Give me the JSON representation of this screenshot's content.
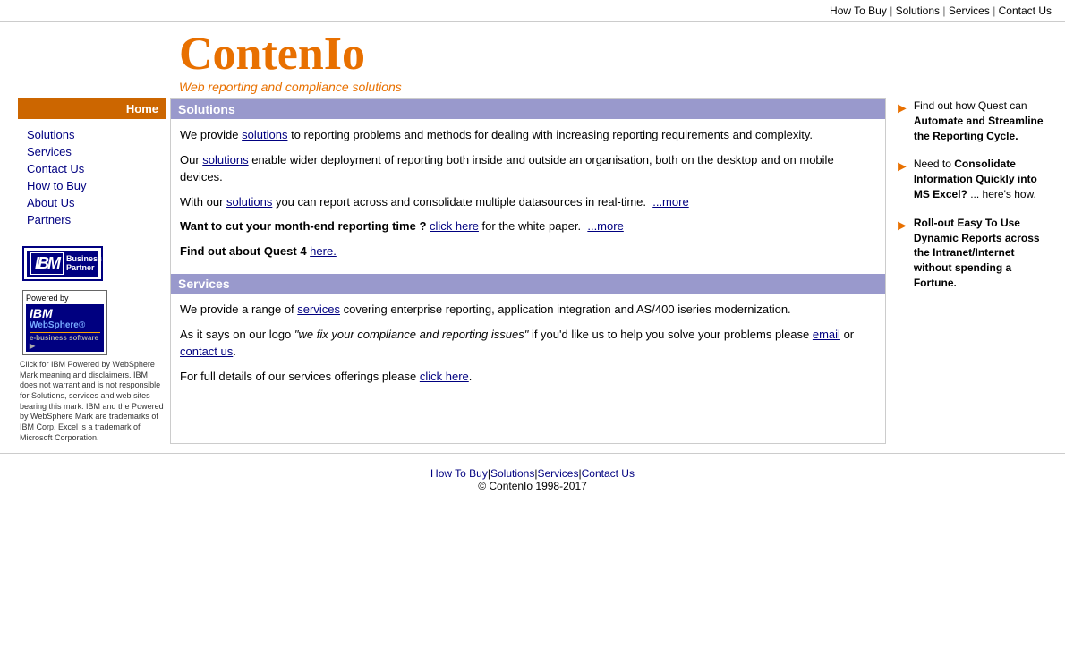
{
  "topnav": {
    "items": [
      {
        "label": "How To Buy",
        "href": "#"
      },
      {
        "label": "Solutions",
        "href": "#"
      },
      {
        "label": "Services",
        "href": "#"
      },
      {
        "label": "Contact Us",
        "href": "#"
      }
    ]
  },
  "header": {
    "logo": "ContenIo",
    "tagline": "Web reporting and compliance solutions"
  },
  "sidebar": {
    "home_label": "Home",
    "nav_items": [
      {
        "label": "Solutions",
        "href": "#"
      },
      {
        "label": "Services",
        "href": "#"
      },
      {
        "label": "Contact Us",
        "href": "#"
      },
      {
        "label": "How to Buy",
        "href": "#"
      },
      {
        "label": "About Us",
        "href": "#"
      },
      {
        "label": "Partners",
        "href": "#"
      }
    ],
    "ibm_badge": {
      "ibm_text": "IBM",
      "business_partner": "Business Partner"
    },
    "websphere_powered_by": "Powered by",
    "websphere_name": "WebSphere",
    "websphere_subtitle": "e-business software",
    "websphere_disclaimer": "Click for IBM Powered by WebSphere Mark meaning and disclaimers. IBM does not warrant and is not responsible for Solutions, services and web sites bearing this mark. IBM and the Powered by WebSphere Mark are trademarks of IBM Corp.\nExcel is a trademark of Microsoft Corporation."
  },
  "solutions_section": {
    "heading": "Solutions",
    "para1": "We provide ",
    "para1_link": "solutions",
    "para1_rest": " to reporting problems and methods for dealing with increasing reporting requirements and complexity.",
    "para2": "Our ",
    "para2_link": "solutions",
    "para2_rest": " enable wider deployment of reporting both inside and outside an organisation, both on the desktop and on mobile devices.",
    "para3": "With our ",
    "para3_link": "solutions",
    "para3_rest": " you can report across and consolidate multiple datasources in real-time.",
    "para3_more": "...more",
    "whitepaper": "Want to cut your month-end reporting time ? ",
    "whitepaper_link": "click here",
    "whitepaper_rest": " for the white paper.",
    "whitepaper_more": "...more",
    "quest": "Find out about Quest 4 ",
    "quest_link": "here."
  },
  "services_section": {
    "heading": "Services",
    "para1": "We provide a range of ",
    "para1_link": "services",
    "para1_rest": " covering enterprise reporting, application integration and AS/400 iseries modernization.",
    "para2_pre": "As it says on our logo ",
    "para2_italic": "\"we fix your compliance and reporting issues\"",
    "para2_rest": " if you'd like us to help you solve your problems please ",
    "para2_email": "email",
    "para2_or": " or ",
    "para2_contact": "contact us",
    "para2_end": ".",
    "para3": "For full details of our services offerings please ",
    "para3_link": "click here",
    "para3_end": "."
  },
  "right_sidebar": {
    "items": [
      {
        "text_before": "Find out how Quest can ",
        "bold": "Automate and Streamline the Reporting Cycle.",
        "text_after": ""
      },
      {
        "text_before": "Need to ",
        "bold": "Consolidate Information Quickly into MS Excel?",
        "text_after": " ... here's how."
      },
      {
        "text_before": "",
        "bold": "Roll-out Easy To Use Dynamic Reports across the Intranet/Internet without spending a Fortune.",
        "text_after": ""
      }
    ]
  },
  "footer": {
    "nav_items": [
      {
        "label": "How To Buy",
        "href": "#"
      },
      {
        "label": "Solutions",
        "href": "#"
      },
      {
        "label": "Services",
        "href": "#"
      },
      {
        "label": "Contact Us",
        "href": "#"
      }
    ],
    "copyright": "© ContenIo 1998-2017"
  }
}
